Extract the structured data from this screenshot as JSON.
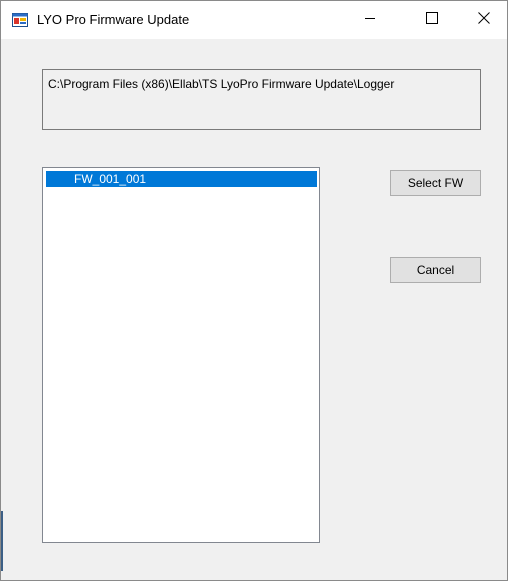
{
  "window": {
    "title": "LYO Pro Firmware Update",
    "icon": "app-window-icon",
    "controls": {
      "minimize_icon": "minimize-icon",
      "maximize_icon": "maximize-icon",
      "close_icon": "close-icon"
    }
  },
  "path_box": {
    "text": "C:\\Program Files (x86)\\Ellab\\TS LyoPro Firmware Update\\Logger"
  },
  "firmware_list": {
    "items": [
      {
        "label": "FW_001_001",
        "selected": true
      }
    ]
  },
  "buttons": {
    "select_fw": "Select FW",
    "cancel": "Cancel"
  },
  "colors": {
    "selection": "#0078d7",
    "background": "#f0f0f0",
    "button_face": "#e1e1e1"
  }
}
